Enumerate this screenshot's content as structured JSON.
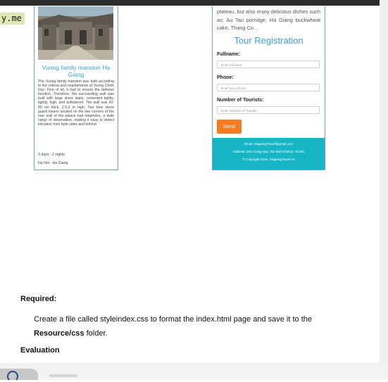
{
  "corner_tag": "y.me",
  "tour_card": {
    "title": "Vuong family mansion Ha Giang",
    "description": "The Vuong family mansion was built according to the criteria and requirements of Vuong Chinh Duc. First of all, it had to ensure the defense function. Therefore, the surrounding wall was built with large stone slabs, cemented tightly, tightly, high, and bulletproof. The wall was 60-80 cm thick, 2.5-3 m high. Two blue stone guard towers located on the two corners of the rear wall of the palace had loopholes, a wide range of observation, making it easy to detect intruders from both sides and behind.",
    "duration": "3 days - 2 nights",
    "route": "Ha Noi - Ha Giang"
  },
  "registration": {
    "intro_text": "plateau, but also enjoy delicious dishes such as: Au Tau porridge, Ha Giang buckwheat cake, Thang Co...",
    "title": "Tour Registration",
    "fullname_label": "Fullname:",
    "fullname_placeholder": "Enter fullname",
    "phone_label": "Phone:",
    "phone_placeholder": "Enter your phone",
    "tourists_label": "Number of Tourists:",
    "tourists_placeholder": "Enter Number of Tourists",
    "send_label": "Send"
  },
  "footer": {
    "email": "Email: HagiangTravel@gmail.com",
    "address": "Address: 18/2 Cong Hoa, Tan Binh District, HCMC",
    "copyright": "© Copyright 2024. HagiangTravel.vn"
  },
  "document": {
    "required_heading": "Required:",
    "instruction_text": "Create a file called styleindex.css to format the index.html page and save it to the",
    "instruction_folder": "Resource/css",
    "instruction_suffix": "folder.",
    "evaluation_heading": "Evaluation"
  },
  "colors": {
    "accent_blue": "#3ba0d9",
    "send_orange": "#f47b20",
    "footer_teal": "#16b6c6"
  }
}
